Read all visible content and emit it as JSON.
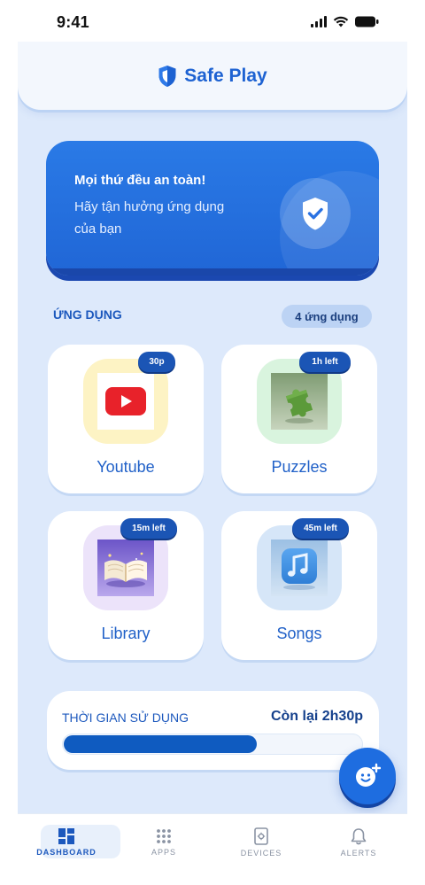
{
  "status_bar": {
    "time": "9:41"
  },
  "header": {
    "title": "Safe Play"
  },
  "banner": {
    "title": "Mọi thứ đều an toàn!",
    "subtitle": "Hãy tận hưởng ứng dụng của bạn"
  },
  "apps_section": {
    "title": "ỨNG DỤNG",
    "count_badge": "4 ứng dụng",
    "apps": [
      {
        "label": "Youtube",
        "time_badge": "30p",
        "tile_color": "#fdf3c4",
        "icon": "youtube-icon"
      },
      {
        "label": "Puzzles",
        "time_badge": "1h left",
        "tile_color": "#d9f4de",
        "icon": "puzzle-piece-icon"
      },
      {
        "label": "Library",
        "time_badge": "15m left",
        "tile_color": "#ece3fa",
        "icon": "open-book-icon"
      },
      {
        "label": "Songs",
        "time_badge": "45m left",
        "tile_color": "#d6e6f8",
        "icon": "music-note-icon"
      }
    ]
  },
  "usage": {
    "label": "THỜI GIAN SỬ DỤNG",
    "remaining": "Còn lại 2h30p",
    "progress": 0.65
  },
  "fab": {
    "icon": "add-child-face-icon"
  },
  "nav": {
    "items": [
      {
        "label": "DASHBOARD",
        "icon": "dashboard-icon",
        "active": true
      },
      {
        "label": "APPS",
        "icon": "apps-grid-icon",
        "active": false
      },
      {
        "label": "DEVICES",
        "icon": "device-icon",
        "active": false
      },
      {
        "label": "ALERTS",
        "icon": "bell-icon",
        "active": false
      }
    ]
  },
  "colors": {
    "primary": "#1e6de0",
    "background": "#dde9fb",
    "badge": "#1b55b5"
  }
}
